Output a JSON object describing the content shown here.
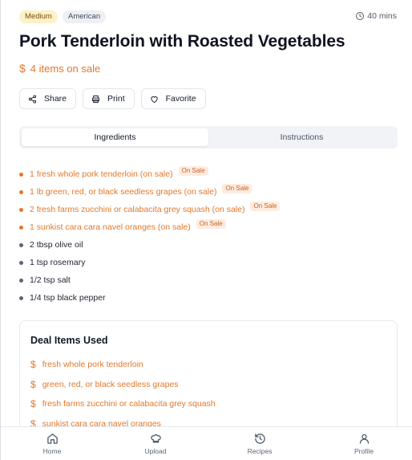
{
  "recipe": {
    "difficulty": "Medium",
    "cuisine": "American",
    "time": "40 mins",
    "title": "Pork Tenderloin with Roasted Vegetables",
    "sale_summary": "4 items on sale"
  },
  "actions": {
    "share": "Share",
    "print": "Print",
    "favorite": "Favorite"
  },
  "tabs": {
    "ingredients": "Ingredients",
    "instructions": "Instructions"
  },
  "ingredients": [
    {
      "text": "1 fresh whole pork tenderloin (on sale)",
      "tag": "On Sale"
    },
    {
      "text": "1 lb green, red, or black seedless grapes (on sale)",
      "tag": "On Sale"
    },
    {
      "text": "2 fresh farms zucchini or calabacita grey squash (on sale)",
      "tag": "On Sale"
    },
    {
      "text": "1 sunkist cara cara navel oranges (on sale)",
      "tag": "On Sale"
    },
    {
      "text": "2 tbsp olive oil"
    },
    {
      "text": "1 tsp rosemary"
    },
    {
      "text": "1/2 tsp salt"
    },
    {
      "text": "1/4 tsp black pepper"
    }
  ],
  "deals": {
    "title": "Deal Items Used",
    "items": [
      "fresh whole pork tenderloin",
      "green, red, or black seedless grapes",
      "fresh farms zucchini or calabacita grey squash",
      "sunkist cara cara navel oranges"
    ]
  },
  "nav": {
    "home": "Home",
    "upload": "Upload",
    "recipes": "Recipes",
    "profile": "Profile"
  },
  "icons": {
    "currency": "$",
    "sale_color": "#e3782b"
  }
}
